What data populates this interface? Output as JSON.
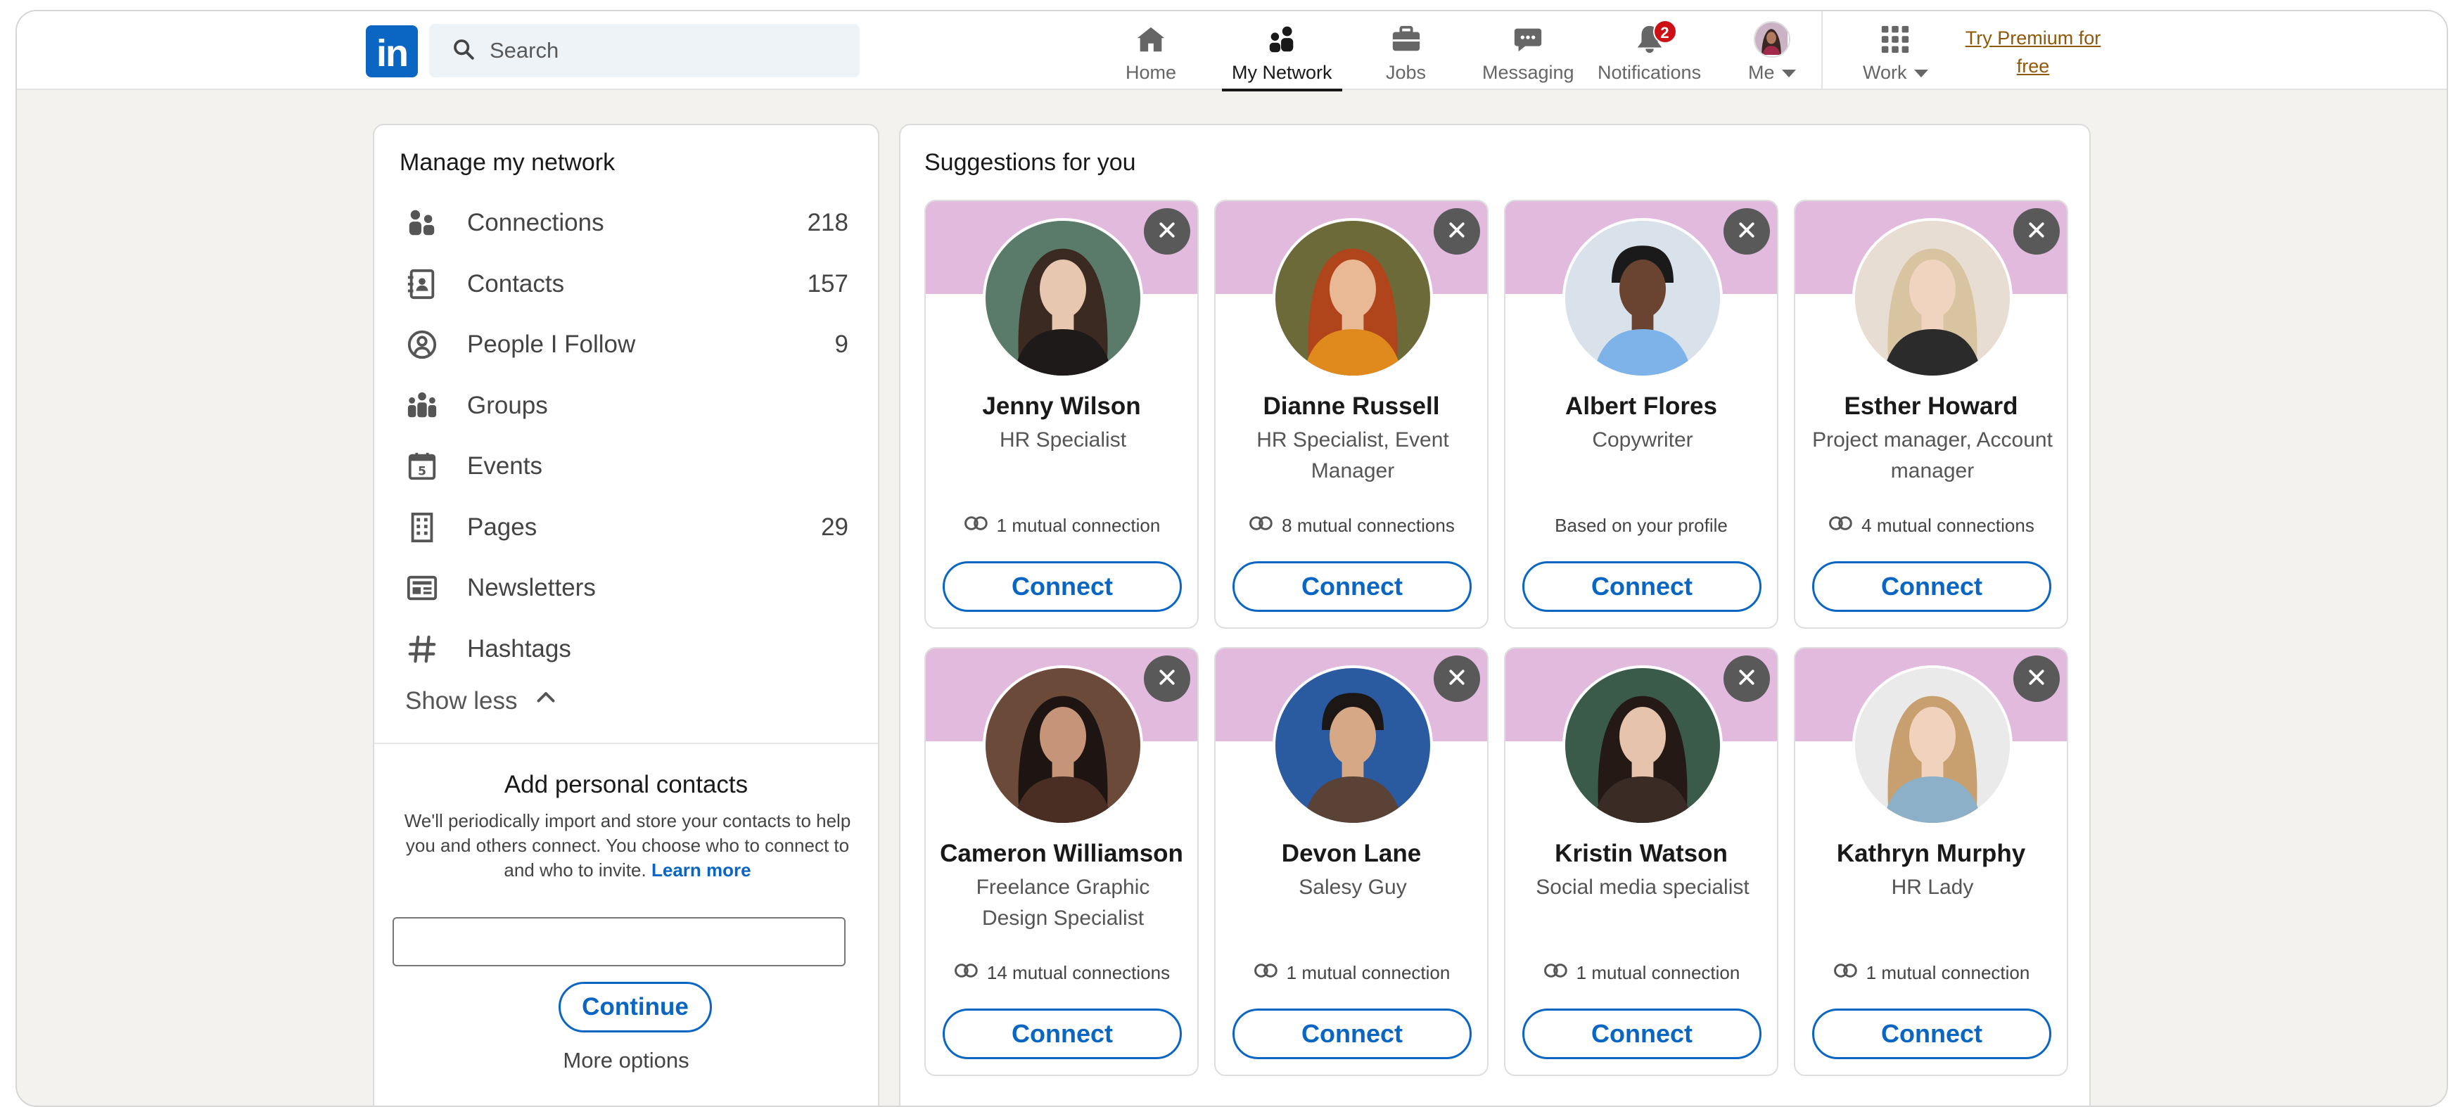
{
  "nav": {
    "logo_text": "in",
    "search_placeholder": "Search",
    "items": [
      {
        "label": "Home",
        "icon": "home-icon"
      },
      {
        "label": "My Network",
        "icon": "network-icon",
        "active": true
      },
      {
        "label": "Jobs",
        "icon": "briefcase-icon"
      },
      {
        "label": "Messaging",
        "icon": "messaging-icon"
      },
      {
        "label": "Notifications",
        "icon": "bell-icon",
        "badge": "2"
      },
      {
        "label": "Me",
        "icon": "avatar"
      },
      {
        "label": "Work",
        "icon": "grid-icon"
      }
    ],
    "premium_line1": "Try Premium for",
    "premium_line2": "free"
  },
  "manage": {
    "title": "Manage my network",
    "items": [
      {
        "label": "Connections",
        "count": "218",
        "icon": "connections-icon"
      },
      {
        "label": "Contacts",
        "count": "157",
        "icon": "contacts-icon"
      },
      {
        "label": "People I Follow",
        "count": "9",
        "icon": "follow-icon"
      },
      {
        "label": "Groups",
        "count": "",
        "icon": "groups-icon"
      },
      {
        "label": "Events",
        "count": "",
        "icon": "calendar-icon"
      },
      {
        "label": "Pages",
        "count": "29",
        "icon": "building-icon"
      },
      {
        "label": "Newsletters",
        "count": "",
        "icon": "newsletter-icon"
      },
      {
        "label": "Hashtags",
        "count": "",
        "icon": "hashtag-icon"
      }
    ],
    "show_less": "Show less"
  },
  "contacts": {
    "title": "Add personal contacts",
    "description": "We'll periodically import and store your contacts to help you and others connect. You choose who to connect to and who to invite.",
    "learn_more": "Learn more",
    "input_value": "",
    "continue_label": "Continue",
    "more_options": "More options"
  },
  "suggestions": {
    "title": "Suggestions for you",
    "connect_label": "Connect",
    "people": [
      {
        "name": "Jenny Wilson",
        "role": "HR Specialist",
        "mutual": "1 mutual connection",
        "show_mutual_icon": true
      },
      {
        "name": "Dianne Russell",
        "role": "HR Specialist, Event Manager",
        "mutual": "8 mutual connections",
        "show_mutual_icon": true
      },
      {
        "name": "Albert Flores",
        "role": "Copywriter",
        "mutual": "Based on your profile",
        "show_mutual_icon": false
      },
      {
        "name": "Esther Howard",
        "role": "Project manager, Account manager",
        "mutual": "4 mutual connections",
        "show_mutual_icon": true
      },
      {
        "name": "Cameron Williamson",
        "role": "Freelance Graphic Design Specialist",
        "mutual": "14 mutual connections",
        "show_mutual_icon": true
      },
      {
        "name": "Devon Lane",
        "role": "Salesy Guy",
        "mutual": "1 mutual connection",
        "show_mutual_icon": true
      },
      {
        "name": "Kristin Watson",
        "role": "Social media specialist",
        "mutual": "1 mutual connection",
        "show_mutual_icon": true
      },
      {
        "name": "Kathryn Murphy",
        "role": "HR Lady",
        "mutual": "1 mutual connection",
        "show_mutual_icon": true
      }
    ]
  },
  "colors": {
    "brand": "#0a66c2",
    "banner": "#e1bade",
    "notification_badge": "#cc1016",
    "premium": "#915907"
  }
}
